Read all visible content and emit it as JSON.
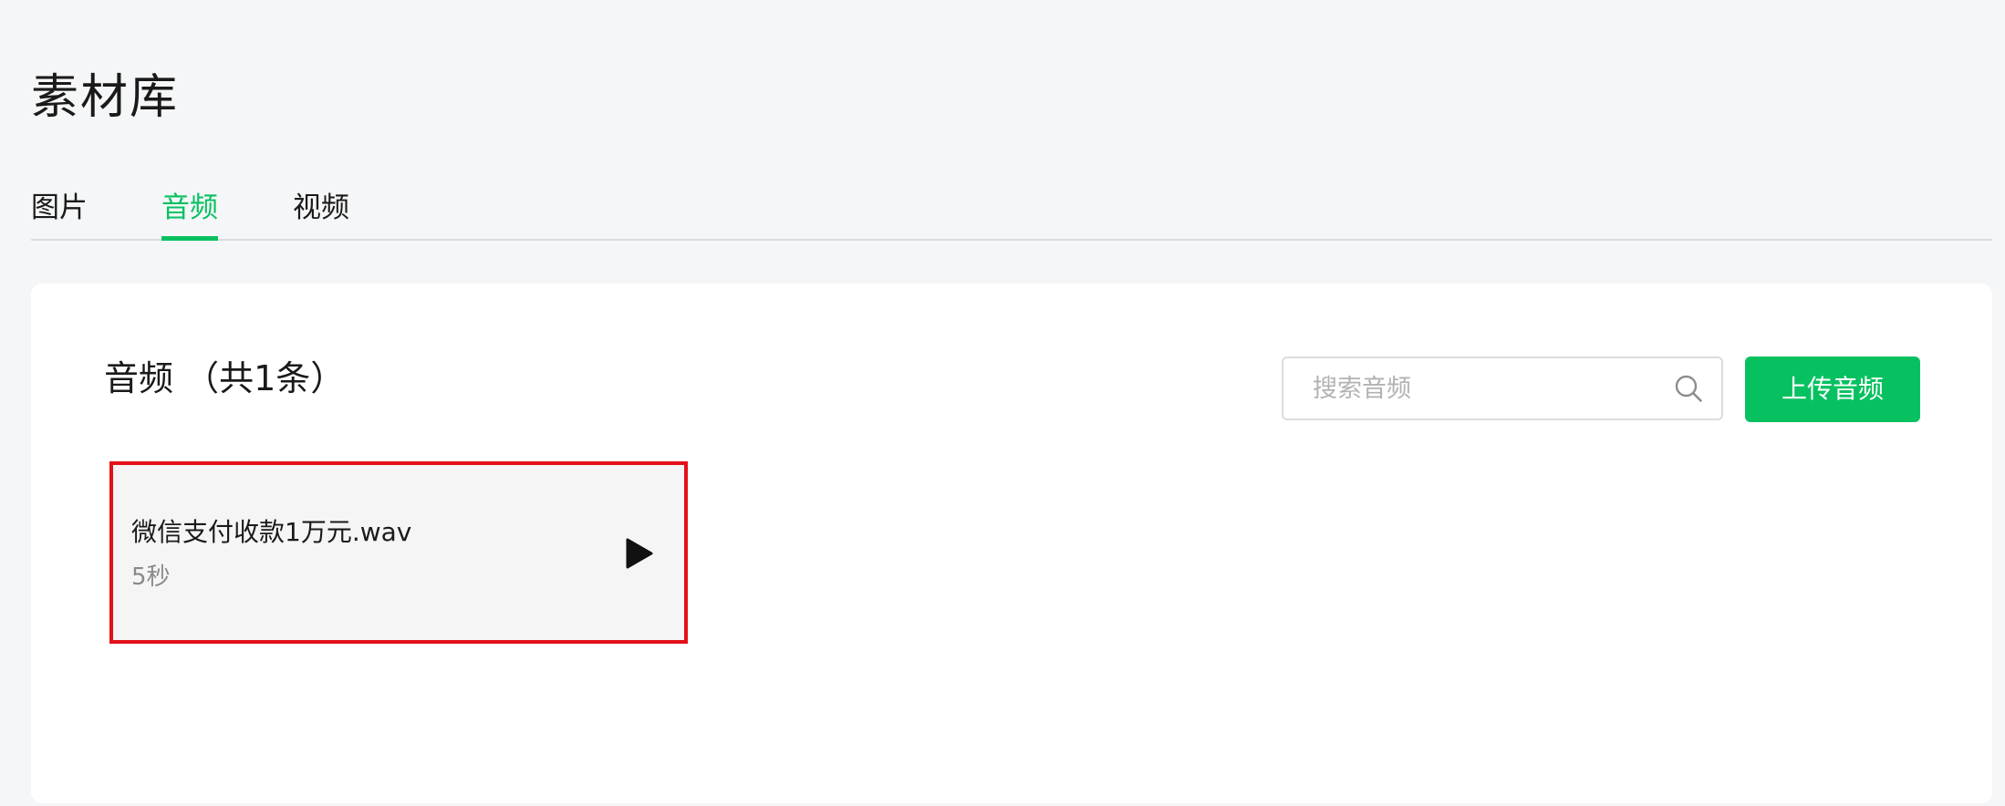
{
  "page": {
    "title": "素材库"
  },
  "tabs": [
    {
      "label": "图片",
      "active": false
    },
    {
      "label": "音频",
      "active": true
    },
    {
      "label": "视频",
      "active": false
    }
  ],
  "panel": {
    "section_title": "音频 （共1条）",
    "search": {
      "placeholder": "搜索音频",
      "value": "",
      "icon": "search-icon"
    },
    "upload_button_label": "上传音频",
    "items": [
      {
        "name": "微信支付收款1万元.wav",
        "duration": "5秒",
        "icon": "play-icon",
        "selected": true
      }
    ]
  },
  "colors": {
    "accent": "#07c160",
    "background": "#f5f6f7",
    "panel": "#ffffff",
    "card": "#f5f5f5",
    "selection_outline": "#e3101a",
    "secondary_text": "#8a8a8a",
    "tab_divider": "#dcdcdc"
  }
}
